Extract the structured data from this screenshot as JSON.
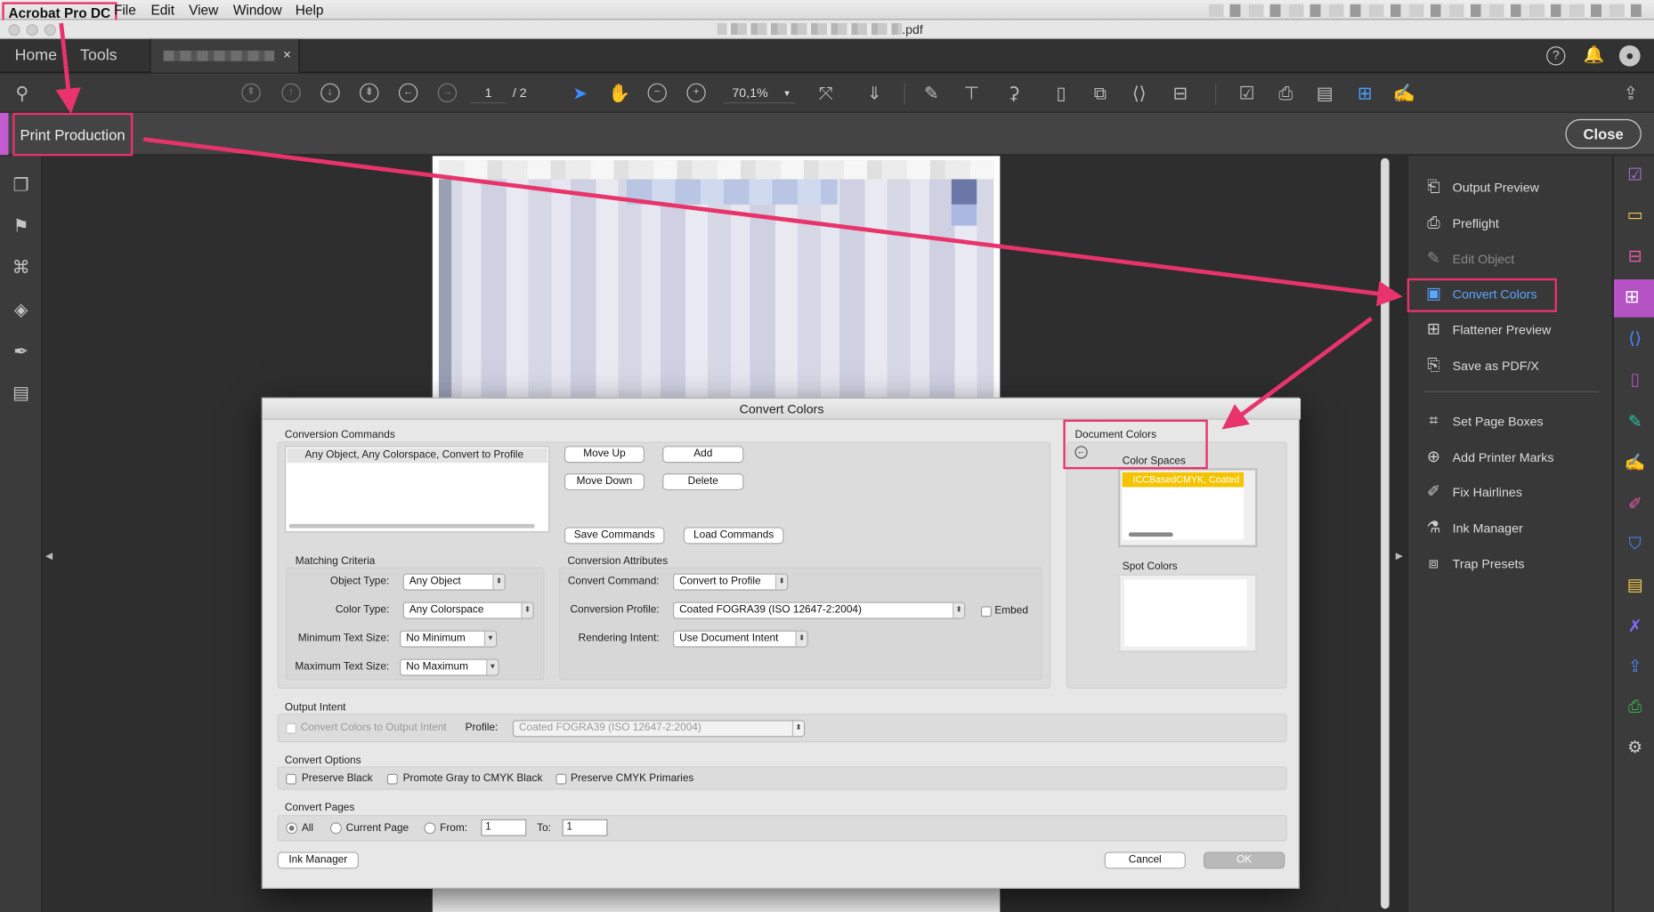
{
  "menubar": {
    "app_name": "Acrobat Pro DC",
    "items": [
      "File",
      "Edit",
      "View",
      "Window",
      "Help"
    ]
  },
  "titlebar": {
    "doc_title_suffix": ".pdf"
  },
  "tabs": {
    "home": "Home",
    "tools": "Tools",
    "doc_close": "×"
  },
  "toolbar": {
    "page_current": "1",
    "page_total": "/ 2",
    "zoom": "70,1%"
  },
  "tool_panel": {
    "title": "Print Production",
    "close_label": "Close"
  },
  "right_pane": {
    "items": [
      {
        "label": "Output Preview",
        "icon": "output-preview-icon",
        "state": "normal"
      },
      {
        "label": "Preflight",
        "icon": "preflight-icon",
        "state": "normal"
      },
      {
        "label": "Edit Object",
        "icon": "edit-object-icon",
        "state": "disabled"
      },
      {
        "label": "Convert Colors",
        "icon": "convert-colors-icon",
        "state": "active"
      },
      {
        "label": "Flattener Preview",
        "icon": "flattener-preview-icon",
        "state": "normal"
      },
      {
        "label": "Save as PDF/X",
        "icon": "save-pdfx-icon",
        "state": "normal"
      },
      {
        "label": "Set Page Boxes",
        "icon": "set-page-boxes-icon",
        "state": "normal"
      },
      {
        "label": "Add Printer Marks",
        "icon": "add-printer-marks-icon",
        "state": "normal"
      },
      {
        "label": "Fix Hairlines",
        "icon": "fix-hairlines-icon",
        "state": "normal"
      },
      {
        "label": "Ink Manager",
        "icon": "ink-manager-icon",
        "state": "normal"
      },
      {
        "label": "Trap Presets",
        "icon": "trap-presets-icon",
        "state": "normal"
      }
    ]
  },
  "dialog": {
    "title": "Convert Colors",
    "conversion_commands": {
      "heading": "Conversion Commands",
      "list_items": [
        "Any Object, Any Colorspace, Convert to Profile"
      ],
      "move_up": "Move Up",
      "move_down": "Move Down",
      "add": "Add",
      "delete": "Delete",
      "save_commands": "Save Commands",
      "load_commands": "Load Commands"
    },
    "matching_criteria": {
      "heading": "Matching Criteria",
      "object_type_label": "Object Type:",
      "object_type_value": "Any Object",
      "color_type_label": "Color Type:",
      "color_type_value": "Any Colorspace",
      "min_text_label": "Minimum Text Size:",
      "min_text_value": "No Minimum",
      "max_text_label": "Maximum Text Size:",
      "max_text_value": "No Maximum"
    },
    "conversion_attributes": {
      "heading": "Conversion Attributes",
      "command_label": "Convert Command:",
      "command_value": "Convert to Profile",
      "profile_label": "Conversion Profile:",
      "profile_value": "Coated FOGRA39 (ISO 12647-2:2004)",
      "embed_label": "Embed",
      "intent_label": "Rendering Intent:",
      "intent_value": "Use Document Intent"
    },
    "document_colors": {
      "heading": "Document Colors",
      "color_spaces_label": "Color Spaces",
      "color_space_item": "ICCBasedCMYK, Coated",
      "spot_colors_label": "Spot Colors"
    },
    "output_intent": {
      "heading": "Output Intent",
      "checkbox_label": "Convert Colors to Output Intent",
      "profile_label": "Profile:",
      "profile_value": "Coated FOGRA39 (ISO 12647-2:2004)"
    },
    "convert_options": {
      "heading": "Convert Options",
      "preserve_black": "Preserve Black",
      "promote_gray": "Promote Gray to CMYK Black",
      "preserve_primaries": "Preserve CMYK Primaries"
    },
    "convert_pages": {
      "heading": "Convert Pages",
      "all": "All",
      "current": "Current Page",
      "from_label": "From:",
      "from_value": "1",
      "to_label": "To:",
      "to_value": "1"
    },
    "ink_manager": "Ink Manager",
    "cancel": "Cancel",
    "ok": "OK"
  },
  "colors": {
    "annotation": "#e8336b",
    "accent_purple": "#b553c4",
    "active_blue": "#5aa6ff",
    "highlight_yellow": "#f5c400"
  }
}
